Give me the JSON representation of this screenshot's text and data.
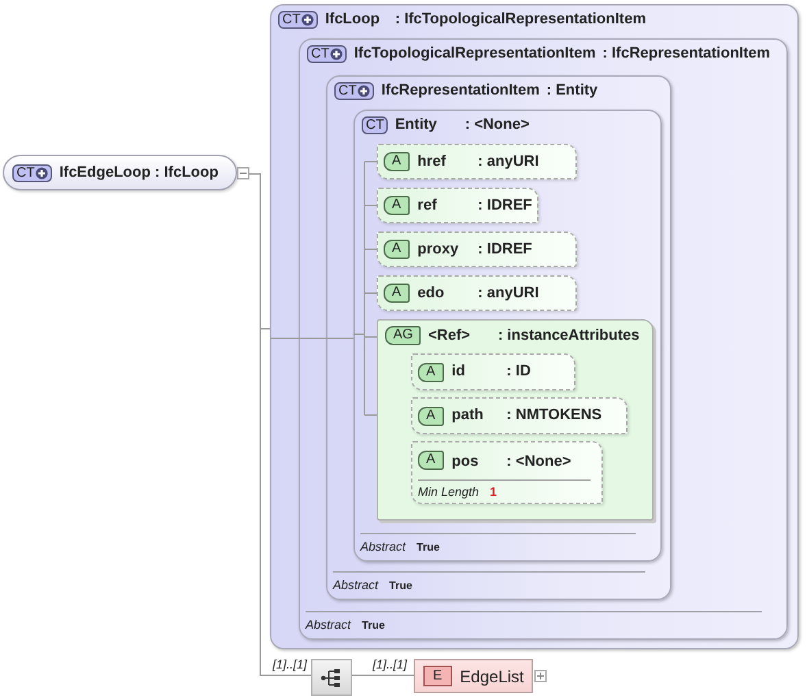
{
  "root": {
    "badge": "CT",
    "derived": true,
    "name": "IfcEdgeLoop",
    "type": ": IfcLoop",
    "expanded": true
  },
  "types": [
    {
      "badge": "CT",
      "derived": true,
      "name": "IfcLoop",
      "type": ": IfcTopologicalRepresentationItem"
    },
    {
      "badge": "CT",
      "derived": true,
      "name": "IfcTopologicalRepresentationItem",
      "type": ": IfcRepresentationItem",
      "abstract_label": "Abstract",
      "abstract_value": "True"
    },
    {
      "badge": "CT",
      "derived": true,
      "name": "IfcRepresentationItem",
      "type": ": Entity",
      "abstract_label": "Abstract",
      "abstract_value": "True"
    },
    {
      "badge": "CT",
      "derived": false,
      "name": "Entity",
      "type": ": <None>",
      "abstract_label": "Abstract",
      "abstract_value": "True"
    }
  ],
  "attributes": [
    {
      "badge": "A",
      "name": "href",
      "type": ": anyURI"
    },
    {
      "badge": "A",
      "name": "ref",
      "type": ": IDREF"
    },
    {
      "badge": "A",
      "name": "proxy",
      "type": ": IDREF"
    },
    {
      "badge": "A",
      "name": "edo",
      "type": ": anyURI"
    }
  ],
  "attribute_group": {
    "badge": "AG",
    "name": "<Ref>",
    "type": ": instanceAttributes",
    "attributes": [
      {
        "badge": "A",
        "name": "id",
        "type": ": ID"
      },
      {
        "badge": "A",
        "name": "path",
        "type": ": NMTOKENS"
      },
      {
        "badge": "A",
        "name": "pos",
        "type": ": <None>",
        "facet_label": "Min Length",
        "facet_value": "1"
      }
    ]
  },
  "sequence": {
    "cardinality": "[1]..[1]",
    "element_cardinality": "[1]..[1]",
    "element": {
      "badge": "E",
      "name": "EdgeList",
      "expanded": false
    }
  }
}
